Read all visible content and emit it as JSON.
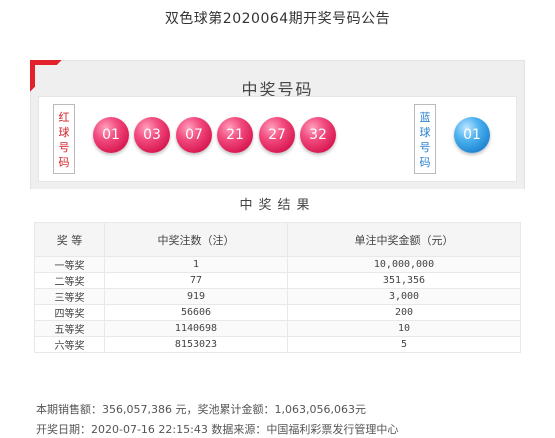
{
  "page_title": "双色球第2020064期开奖号码公告",
  "draw": {
    "heading": "中奖号码",
    "red_label": [
      "红",
      "球",
      "号",
      "码"
    ],
    "blue_label": [
      "蓝",
      "球",
      "号",
      "码"
    ],
    "red_balls": [
      "01",
      "03",
      "07",
      "21",
      "27",
      "32"
    ],
    "blue_balls": [
      "01"
    ],
    "colors": {
      "red_ball": "#e0265d",
      "blue_ball": "#2a8ad8",
      "corner_accent": "#e3212b"
    }
  },
  "results": {
    "heading": "中奖结果",
    "columns": [
      "奖 等",
      "中奖注数（注）",
      "单注中奖金额（元）"
    ],
    "rows": [
      {
        "level": "一等奖",
        "count": "1",
        "amount": "10,000,000"
      },
      {
        "level": "二等奖",
        "count": "77",
        "amount": "351,356"
      },
      {
        "level": "三等奖",
        "count": "919",
        "amount": "3,000"
      },
      {
        "level": "四等奖",
        "count": "56606",
        "amount": "200"
      },
      {
        "level": "五等奖",
        "count": "1140698",
        "amount": "10"
      },
      {
        "level": "六等奖",
        "count": "8153023",
        "amount": "5"
      }
    ]
  },
  "footer": {
    "sales": "本期销售额：356,057,386 元，奖池累计金额：1,063,056,063元",
    "draw_info": "开奖日期：2020-07-16 22:15:43 数据来源：中国福利彩票发行管理中心"
  }
}
